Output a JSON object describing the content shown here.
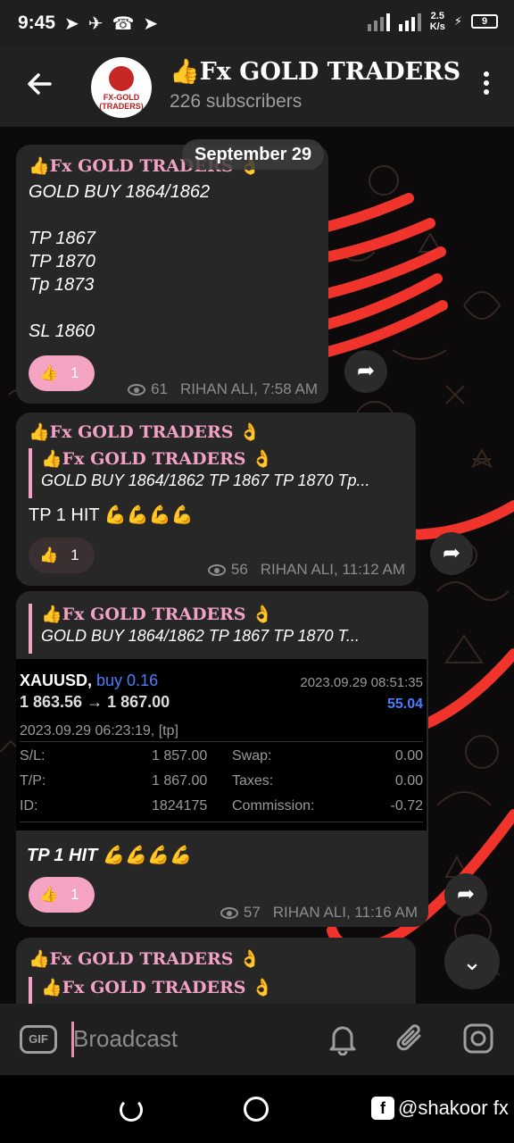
{
  "status_bar": {
    "time": "9:45",
    "speed": "2.5\nK/s",
    "battery": "9"
  },
  "header": {
    "back_icon": "arrow-left-icon",
    "avatar_text": "FX-GOLD\n(TRADERS)",
    "title": "👍Fx GOLD TRADERS",
    "subtitle": "226 subscribers"
  },
  "chat": {
    "date_label": "September 29",
    "messages": [
      {
        "author": "👍Fx GOLD TRADERS 👌",
        "lines": [
          "GOLD BUY 1864/1862",
          "",
          "TP 1867",
          "TP 1870",
          "Tp 1873",
          "",
          "SL 1860"
        ],
        "reaction_emoji": "👍",
        "reaction_count": "1",
        "views": "61",
        "signature": "RIHAN ALI, 7:58 AM"
      },
      {
        "author": "👍Fx GOLD TRADERS 👌",
        "quote_author": "👍Fx GOLD TRADERS 👌",
        "quote_text": "GOLD BUY 1864/1862  TP 1867 TP 1870 Tp...",
        "text": "TP 1 HIT 💪💪💪💪",
        "reaction_emoji": "👍",
        "reaction_count": "1",
        "views": "56",
        "signature": "RIHAN ALI, 11:12 AM"
      },
      {
        "quote_author": "👍Fx GOLD TRADERS 👌",
        "quote_text": "GOLD BUY 1864/1862  TP 1867 TP 1870 T...",
        "text": "TP 1 HIT 💪💪💪💪",
        "reaction_emoji": "👍",
        "reaction_count": "1",
        "views": "57",
        "signature": "RIHAN ALI, 11:16 AM"
      },
      {
        "author": "👍Fx GOLD TRADERS 👌",
        "quote_author": "👍Fx GOLD TRADERS 👌"
      }
    ],
    "trade": {
      "symbol": "XAUUSD,",
      "side": "buy 0.16",
      "timestamp": "2023.09.29 08:51:35",
      "prices": "1 863.56 → 1 867.00",
      "profit": "55.04",
      "open_time": "2023.09.29 06:23:19, [tp]",
      "sl_label": "S/L:",
      "sl_value": "1 857.00",
      "swap_label": "Swap:",
      "swap_value": "0.00",
      "tp_label": "T/P:",
      "tp_value": "1 867.00",
      "taxes_label": "Taxes:",
      "taxes_value": "0.00",
      "id_label": "ID:",
      "id_value": "1824175",
      "commission_label": "Commission:",
      "commission_value": "-0.72"
    }
  },
  "input_bar": {
    "gif_label": "GIF",
    "placeholder": "Broadcast"
  },
  "nav_bar": {
    "watermark": "@shakoor fx",
    "fb_letter": "f"
  },
  "colors": {
    "accent_pink": "#f2a2c4",
    "annotation_red": "#f0332b",
    "header_bg": "#212121",
    "bubble_bg": "#272727"
  }
}
